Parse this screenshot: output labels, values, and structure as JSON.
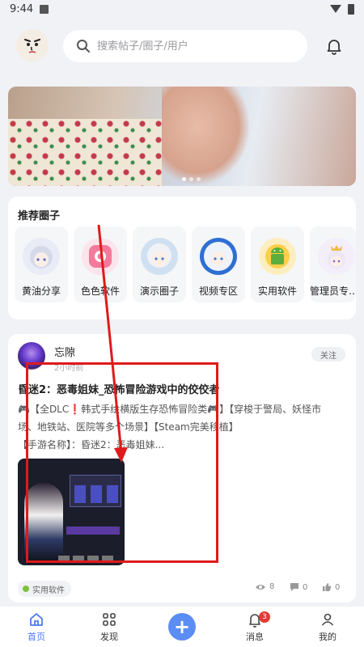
{
  "status": {
    "time": "9:44"
  },
  "search": {
    "placeholder": "搜索帖子/圈子/用户"
  },
  "recommended": {
    "title": "推荐圈子",
    "items": [
      {
        "label": "黄油分享",
        "icon": "anime-girl-avatar-icon"
      },
      {
        "label": "色色软件",
        "icon": "pink-app-icon"
      },
      {
        "label": "演示圈子",
        "icon": "anime-girl-avatar-icon"
      },
      {
        "label": "视频专区",
        "icon": "anime-girl-avatar-icon"
      },
      {
        "label": "实用软件",
        "icon": "android-icon"
      },
      {
        "label": "管理员专…",
        "icon": "anime-girl-avatar-icon"
      }
    ]
  },
  "post": {
    "author": "忘隙",
    "time": "2小时前",
    "follow_label": "关注",
    "title": "昏迷2：恶毒姐妹_恐怖冒险游戏中的佼佼者",
    "body_line1": "🎮【全DLC❗韩式手绘横版生存恐怖冒险类🎮】【穿梭于警局、妖怪市",
    "body_line2": "场、地铁站、医院等多个场景】【Steam完美移植】",
    "body_line3": "【手游名称】：昏迷2：恶毒姐妹...",
    "tag": "实用软件",
    "views": "8",
    "comments": "0",
    "likes": "0"
  },
  "tabs": [
    {
      "label": "首页",
      "icon": "home-icon"
    },
    {
      "label": "发现",
      "icon": "grid-icon"
    },
    {
      "label": "",
      "icon": "plus-icon"
    },
    {
      "label": "消息",
      "icon": "bell-icon",
      "badge": "3"
    },
    {
      "label": "我的",
      "icon": "user-icon"
    }
  ],
  "colors": {
    "accent": "#4a7cf0",
    "plus_button": "#5b8df5",
    "annotation": "#e01a1a",
    "badge": "#e53935"
  }
}
